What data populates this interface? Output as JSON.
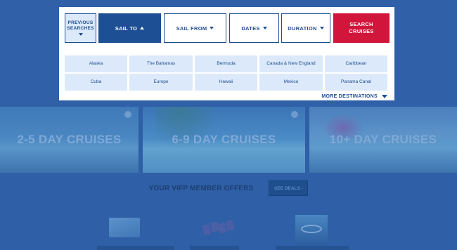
{
  "search": {
    "previous_label_1": "PREVIOUS",
    "previous_label_2": "SEARCHES",
    "sail_to_label": "SAIL TO",
    "sail_from_label": "SAIL FROM",
    "dates_label": "DATES",
    "duration_label": "DURATION",
    "search_label_1": "SEARCH",
    "search_label_2": "CRUISES",
    "destinations": [
      "Alaska",
      "The Bahamas",
      "Bermuda",
      "Canada & New England",
      "Caribbean",
      "Cuba",
      "Europe",
      "Hawaii",
      "Mexico",
      "Panama Canal"
    ],
    "more_label": "MORE DESTINATIONS"
  },
  "tiles": [
    {
      "label": "2-5 DAY CRUISES"
    },
    {
      "label": "6-9 DAY CRUISES"
    },
    {
      "label": "10+ DAY CRUISES"
    }
  ],
  "offers": {
    "title": "YOUR VIFP MEMBER OFFERS",
    "button_label": "SEE DEALS ›"
  },
  "colors": {
    "overlay_blue": "#2f60a8",
    "primary_blue": "#1c4f93",
    "light_blue": "#dbe9fa",
    "search_red": "#d2153a"
  }
}
